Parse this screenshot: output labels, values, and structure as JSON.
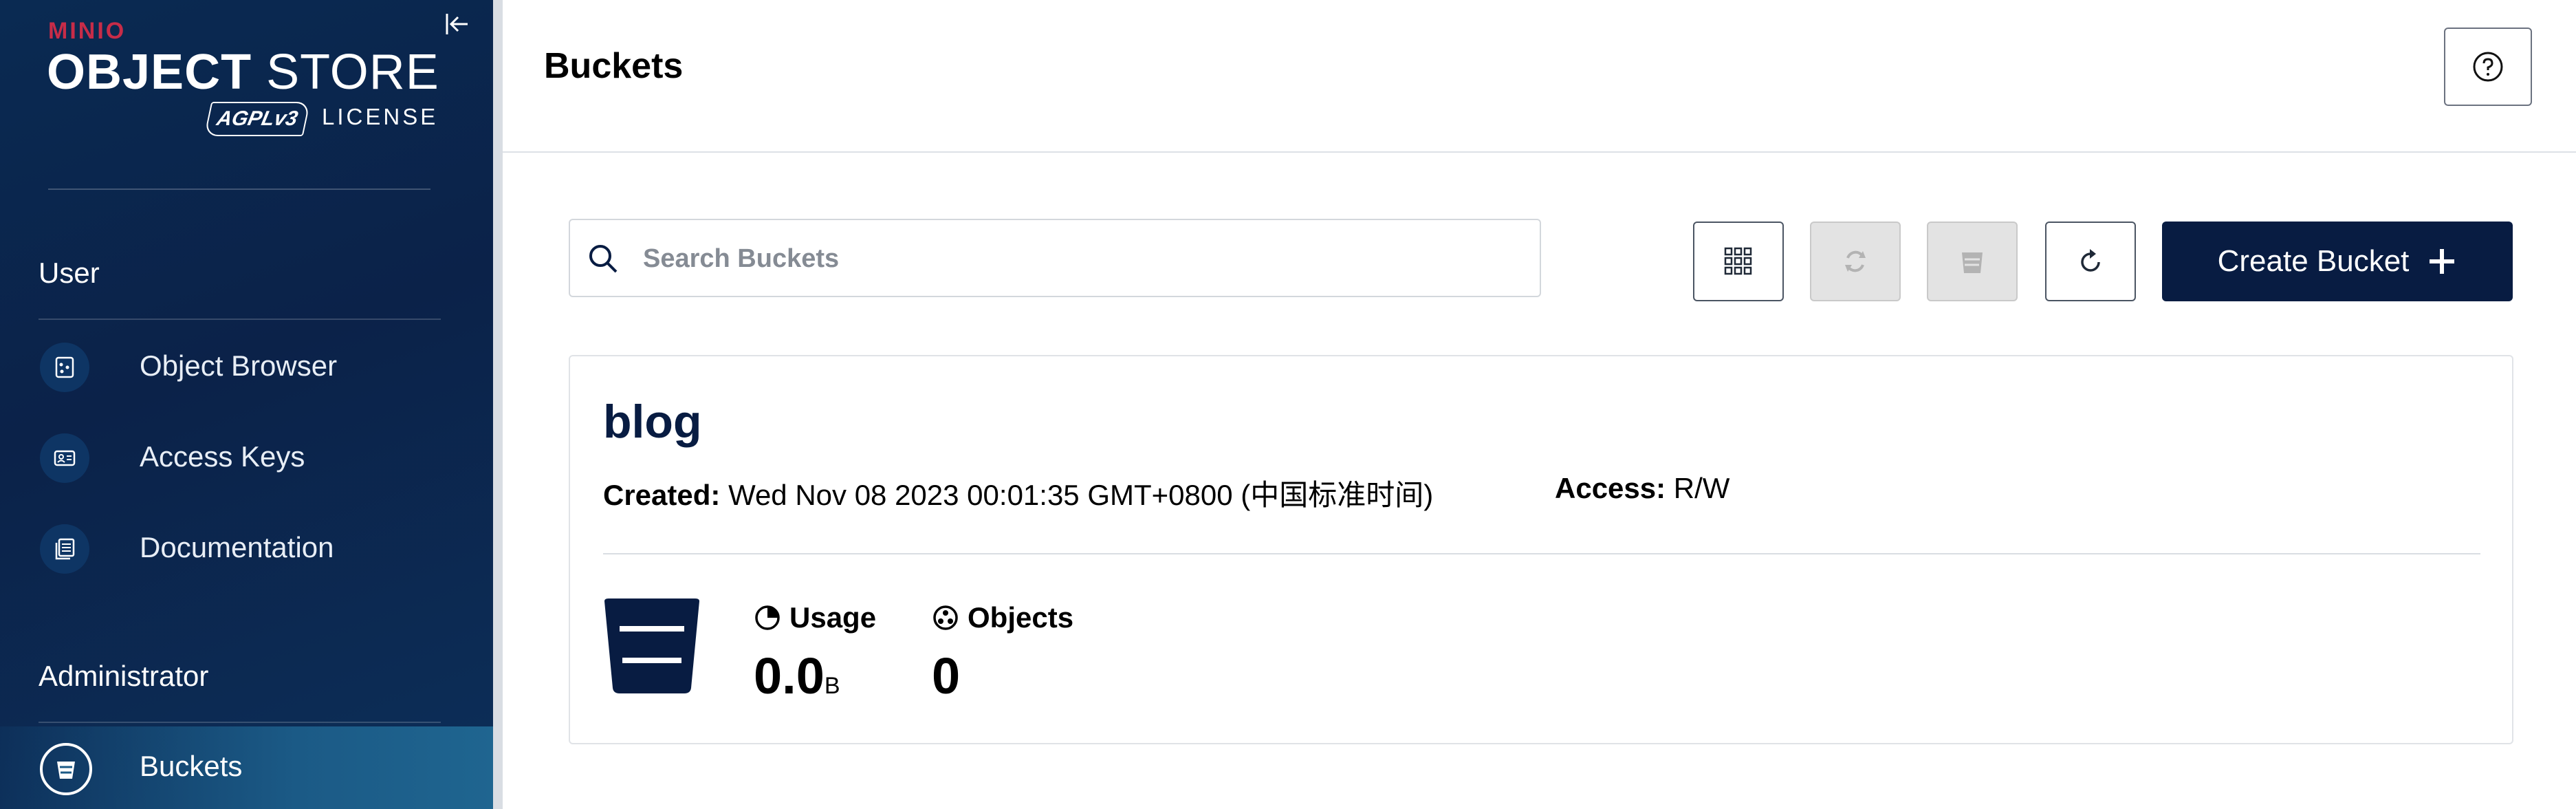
{
  "sidebar": {
    "logo": {
      "brand": "MINIO",
      "product_bold": "OBJECT",
      "product_light": "STORE",
      "license_badge": "AGPLv3",
      "license_text": "LICENSE"
    },
    "sections": [
      {
        "label": "User",
        "items": [
          {
            "label": "Object Browser",
            "icon": "object-browser-icon"
          },
          {
            "label": "Access Keys",
            "icon": "access-keys-icon"
          },
          {
            "label": "Documentation",
            "icon": "documentation-icon"
          }
        ]
      },
      {
        "label": "Administrator",
        "items": [
          {
            "label": "Buckets",
            "icon": "bucket-icon",
            "active": true
          }
        ]
      }
    ]
  },
  "header": {
    "title": "Buckets"
  },
  "toolbar": {
    "search_placeholder": "Search Buckets",
    "create_label": "Create Bucket"
  },
  "buckets": [
    {
      "name": "blog",
      "created_label": "Created:",
      "created_value": "Wed Nov 08 2023 00:01:35 GMT+0800 (中国标准时间)",
      "access_label": "Access:",
      "access_value": "R/W",
      "usage_label": "Usage",
      "usage_value": "0.0",
      "usage_unit": "B",
      "objects_label": "Objects",
      "objects_value": "0"
    }
  ],
  "colors": {
    "sidebar_bg": "#0b2249",
    "accent_navy": "#081c42",
    "brand_red": "#c72c48"
  }
}
